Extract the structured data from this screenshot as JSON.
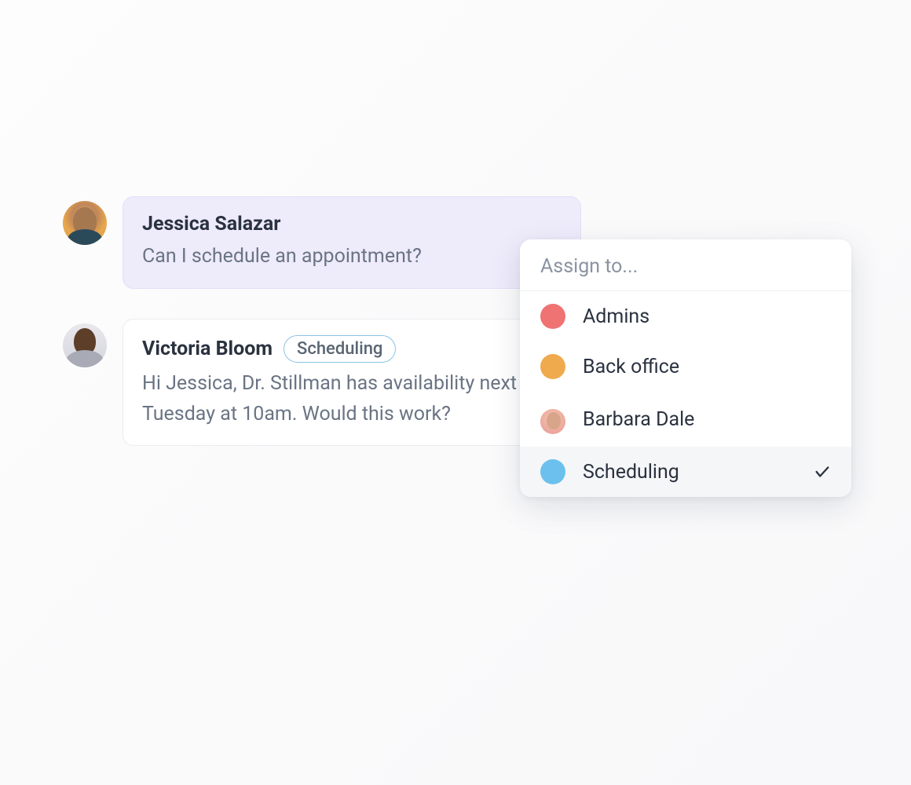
{
  "messages": [
    {
      "sender": "Jessica Salazar",
      "text": "Can I schedule an appointment?",
      "tag": null
    },
    {
      "sender": "Victoria Bloom",
      "text": "Hi Jessica, Dr. Stillman has availability next Tuesday at 10am. Would this work?",
      "tag": "Scheduling"
    }
  ],
  "dropdown": {
    "title": "Assign to...",
    "items": [
      {
        "label": "Admins",
        "color": "#ef7372",
        "type": "dot",
        "selected": false
      },
      {
        "label": "Back office",
        "color": "#efaa4d",
        "type": "dot",
        "selected": false
      },
      {
        "label": "Barbara Dale",
        "color": null,
        "type": "avatar",
        "selected": false
      },
      {
        "label": "Scheduling",
        "color": "#6cc0ed",
        "type": "dot",
        "selected": true
      }
    ]
  }
}
